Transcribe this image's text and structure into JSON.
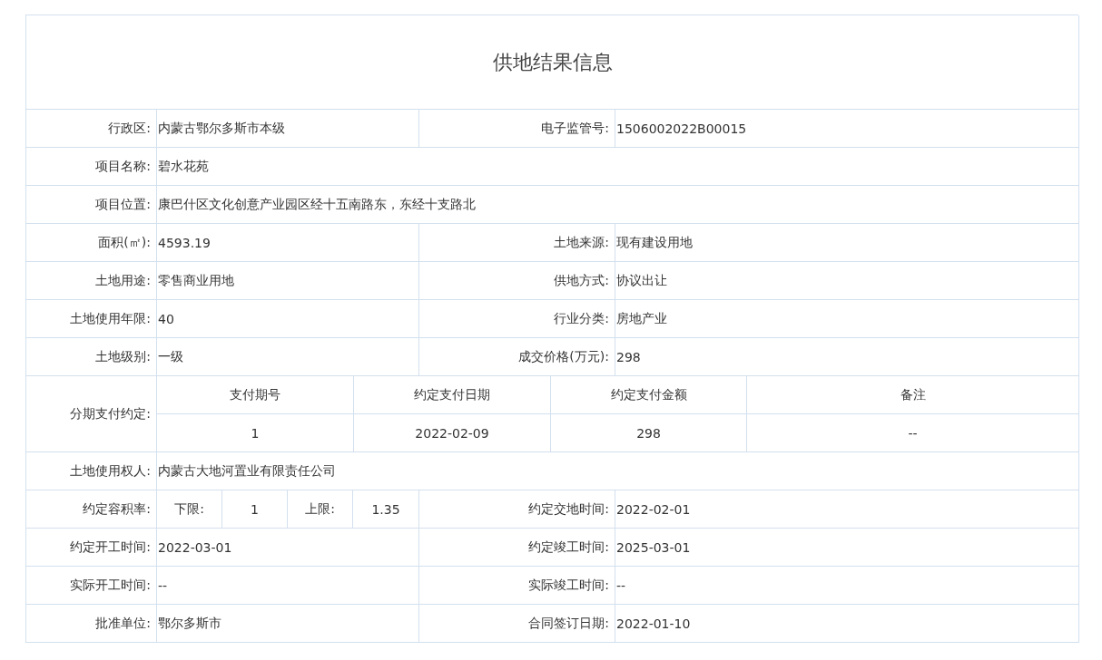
{
  "title": "供地结果信息",
  "rows": [
    {
      "kind": "pair",
      "fields": [
        {
          "label": "行政区:",
          "value": "内蒙古鄂尔多斯市本级"
        },
        {
          "label": "电子监管号:",
          "value": "1506002022B00015"
        }
      ]
    },
    {
      "kind": "single",
      "fields": [
        {
          "label": "项目名称:",
          "value": "碧水花苑"
        }
      ]
    },
    {
      "kind": "single",
      "fields": [
        {
          "label": "项目位置:",
          "value": "康巴什区文化创意产业园区经十五南路东，东经十支路北"
        }
      ]
    },
    {
      "kind": "pair",
      "fields": [
        {
          "label": "面积(㎡):",
          "value": "4593.19"
        },
        {
          "label": "土地来源:",
          "value": "现有建设用地"
        }
      ]
    },
    {
      "kind": "pair",
      "fields": [
        {
          "label": "土地用途:",
          "value": "零售商业用地"
        },
        {
          "label": "供地方式:",
          "value": "协议出让"
        }
      ]
    },
    {
      "kind": "pair",
      "fields": [
        {
          "label": "土地使用年限:",
          "value": "40"
        },
        {
          "label": "行业分类:",
          "value": "房地产业"
        }
      ]
    },
    {
      "kind": "pair",
      "fields": [
        {
          "label": "土地级别:",
          "value": "一级"
        },
        {
          "label": "成交价格(万元):",
          "value": "298"
        }
      ]
    },
    {
      "kind": "installments",
      "label": "分期支付约定:",
      "columns": [
        "支付期号",
        "约定支付日期",
        "约定支付金额",
        "备注"
      ],
      "rows": [
        [
          "1",
          "2022-02-09",
          "298",
          "--"
        ]
      ]
    },
    {
      "kind": "single",
      "fields": [
        {
          "label": "土地使用权人:",
          "value": "内蒙古大地河置业有限责任公司"
        }
      ]
    },
    {
      "kind": "far",
      "label": "约定容积率:",
      "lower_label": "下限:",
      "lower": "1",
      "upper_label": "上限:",
      "upper": "1.35",
      "fields": [
        {
          "label": "约定交地时间:",
          "value": "2022-02-01"
        }
      ]
    },
    {
      "kind": "pair",
      "fields": [
        {
          "label": "约定开工时间:",
          "value": "2022-03-01"
        },
        {
          "label": "约定竣工时间:",
          "value": "2025-03-01"
        }
      ]
    },
    {
      "kind": "pair",
      "fields": [
        {
          "label": "实际开工时间:",
          "value": "--"
        },
        {
          "label": "实际竣工时间:",
          "value": "--"
        }
      ]
    },
    {
      "kind": "pair",
      "fields": [
        {
          "label": "批准单位:",
          "value": "鄂尔多斯市"
        },
        {
          "label": "合同签订日期:",
          "value": "2022-01-10"
        }
      ]
    }
  ]
}
